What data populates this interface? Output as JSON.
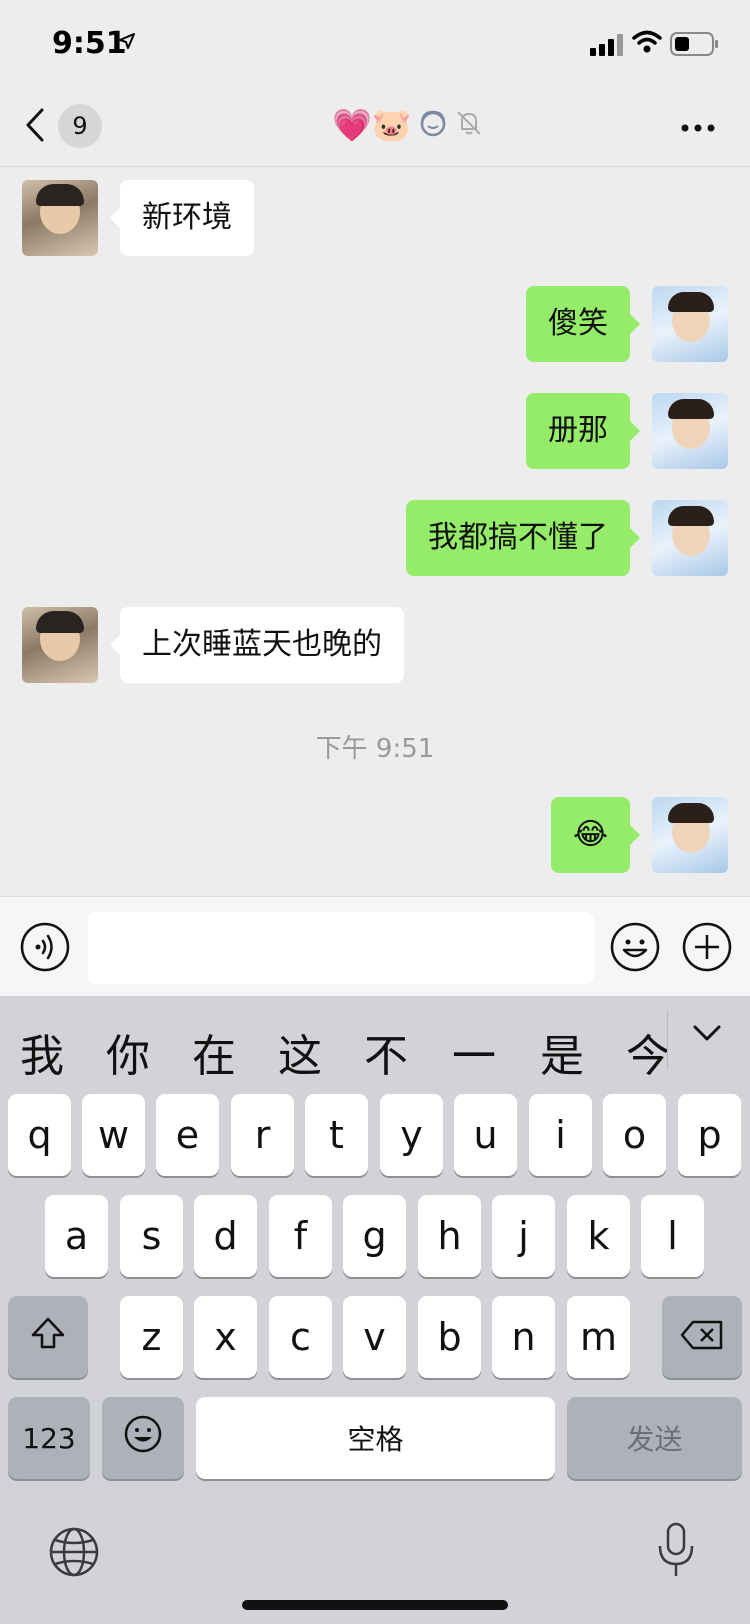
{
  "status_bar": {
    "time": "9:51",
    "icons": [
      "location-arrow-icon",
      "cellular-signal-icon",
      "wifi-icon",
      "battery-icon"
    ]
  },
  "nav": {
    "back_icon": "chevron-left-icon",
    "unread_count": "9",
    "title_emojis": "💗🐷",
    "title_icons": [
      "headset-icon",
      "muted-bell-icon"
    ],
    "more_icon": "more-dots-icon"
  },
  "messages": [
    {
      "side": "in",
      "text": "新环境"
    },
    {
      "side": "out",
      "text": "傻笑"
    },
    {
      "side": "out",
      "text": "册那"
    },
    {
      "side": "out",
      "text": "我都搞不懂了"
    },
    {
      "side": "in",
      "text": "上次睡蓝天也晚的"
    },
    {
      "side": "out",
      "text": "😂"
    }
  ],
  "timestamp": "下午 9:51",
  "input_bar": {
    "value": "",
    "icons": [
      "voice-icon",
      "emoji-face-icon",
      "plus-icon"
    ]
  },
  "keyboard": {
    "candidates": [
      "我",
      "你",
      "在",
      "这",
      "不",
      "一",
      "是",
      "今"
    ],
    "candidate_toggle_icon": "chevron-down-icon",
    "row1": [
      "q",
      "w",
      "e",
      "r",
      "t",
      "y",
      "u",
      "i",
      "o",
      "p"
    ],
    "row2": [
      "a",
      "s",
      "d",
      "f",
      "g",
      "h",
      "j",
      "k",
      "l"
    ],
    "row3": [
      "z",
      "x",
      "c",
      "v",
      "b",
      "n",
      "m"
    ],
    "shift_icon": "shift-icon",
    "delete_icon": "delete-icon",
    "numbers_label": "123",
    "emoji_icon": "emoji-key-icon",
    "space_label": "空格",
    "send_label": "发送",
    "globe_icon": "globe-icon",
    "mic_icon": "microphone-icon"
  }
}
